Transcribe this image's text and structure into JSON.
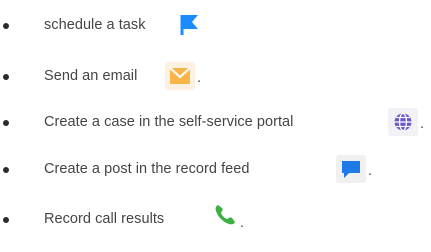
{
  "items": [
    {
      "text": "schedule a task",
      "icon": "flag-icon",
      "icon_color": "#1a8cff",
      "icon_bg": "#ffffff",
      "period": ""
    },
    {
      "text": "Send an email",
      "icon": "envelope-icon",
      "icon_color": "#f7b731",
      "icon_bg": "#fff2e0",
      "period": "."
    },
    {
      "text": "Create a case in the self-service portal",
      "icon": "globe-icon",
      "icon_color": "#6a5acd",
      "icon_bg": "#f0f0f8",
      "period": "."
    },
    {
      "text": "Create a post in the record feed",
      "icon": "speech-bubble-icon",
      "icon_color": "#1e7ae6",
      "icon_bg": "#f0f0f0",
      "period": "."
    },
    {
      "text": "Record call results",
      "icon": "phone-icon",
      "icon_color": "#3cb043",
      "icon_bg": "#ffffff",
      "period": "."
    }
  ]
}
